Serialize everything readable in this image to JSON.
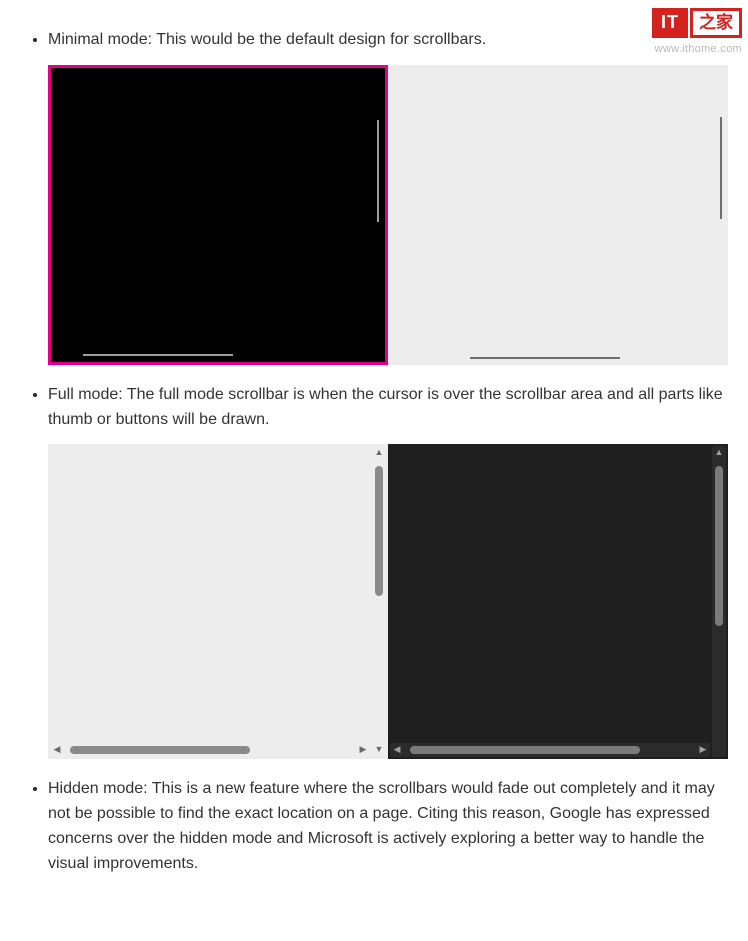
{
  "watermark": {
    "logo_left": "IT",
    "logo_right": "之家",
    "url": "www.ithome.com"
  },
  "items": [
    {
      "text": "Minimal mode: This would be the default design for scrollbars."
    },
    {
      "text": "Full mode: The full mode scrollbar is when the cursor is over the scrollbar area and all parts like thumb or buttons will be drawn."
    },
    {
      "text": "Hidden mode: This is a new feature where the scrollbars would fade out completely and it may not be possible to find the exact location on a page. Citing this reason, Google has expressed concerns over the hidden mode and Microsoft is actively exploring a better way to handle the visual improvements."
    }
  ]
}
